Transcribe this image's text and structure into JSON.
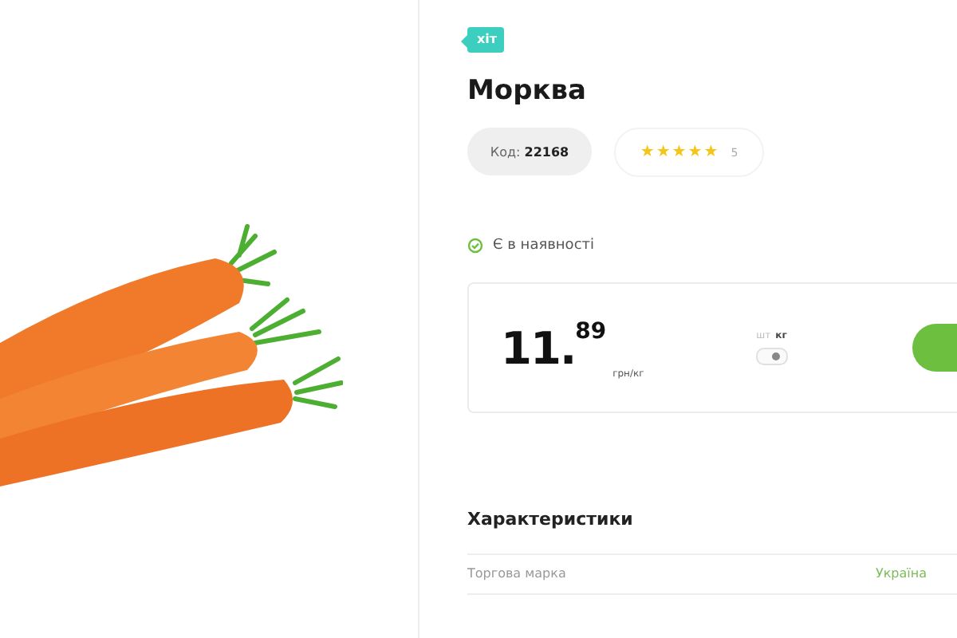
{
  "badge": "хіт",
  "title": "Морква",
  "code": {
    "label": "Код:",
    "value": "22168"
  },
  "rating": {
    "stars": 5,
    "count": "5"
  },
  "stock": {
    "text": "Є в наявності",
    "in_stock": true
  },
  "price": {
    "whole": "11.",
    "fraction": "89",
    "unit": "грн/кг"
  },
  "units": [
    {
      "label": "шт",
      "selected": false
    },
    {
      "label": "кг",
      "selected": true
    }
  ],
  "characteristics": {
    "title": "Характеристики",
    "rows": [
      {
        "name": "Торгова марка",
        "value": "Україна"
      }
    ]
  }
}
